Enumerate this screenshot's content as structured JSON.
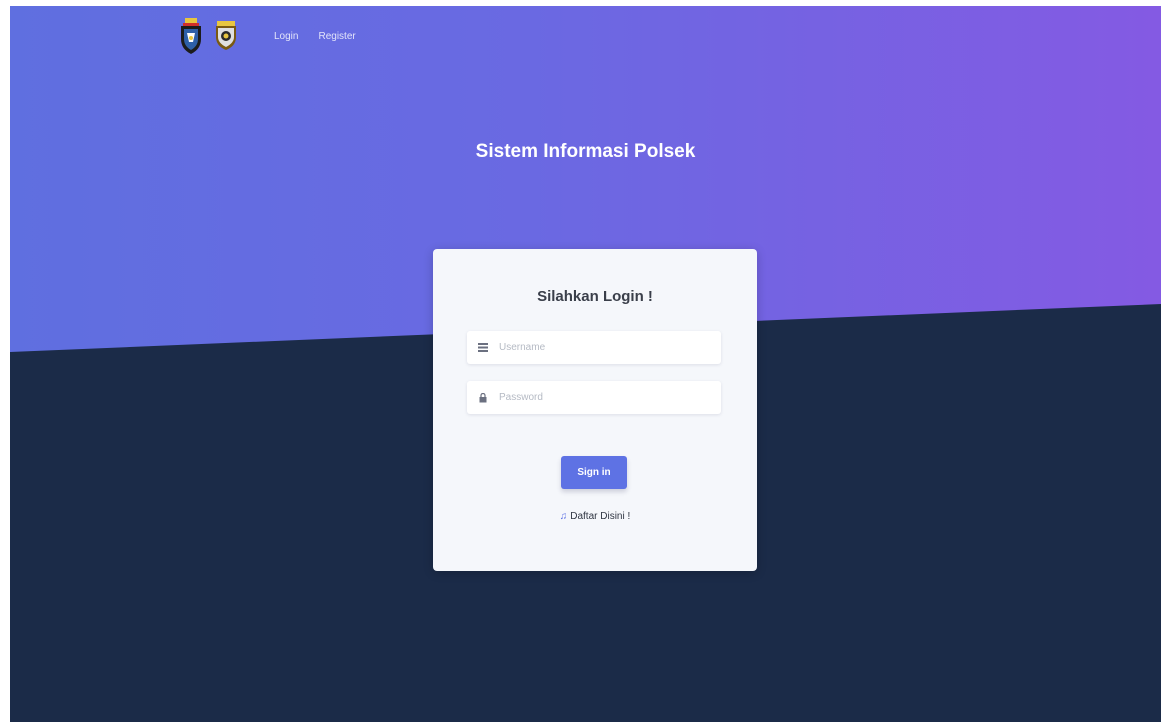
{
  "nav": {
    "logos": [
      "police-crest-logo",
      "police-badge-logo"
    ],
    "links": [
      "Login",
      "Register"
    ]
  },
  "hero": {
    "title": "Sistem Informasi Polsek"
  },
  "login": {
    "heading": "Silahkan Login !",
    "username_placeholder": "Username",
    "password_placeholder": "Password",
    "username_icon": "user-card-icon",
    "password_icon": "lock-icon",
    "signin_label": "Sign in",
    "register_icon": "music-note-icon",
    "register_label": "Daftar Disini !"
  },
  "colors": {
    "gradient_start": "#5f6fe0",
    "gradient_end": "#845ae3",
    "dark_bg": "#1b2b48",
    "card_bg": "#f5f7fb",
    "primary_button": "#5e72e4"
  }
}
